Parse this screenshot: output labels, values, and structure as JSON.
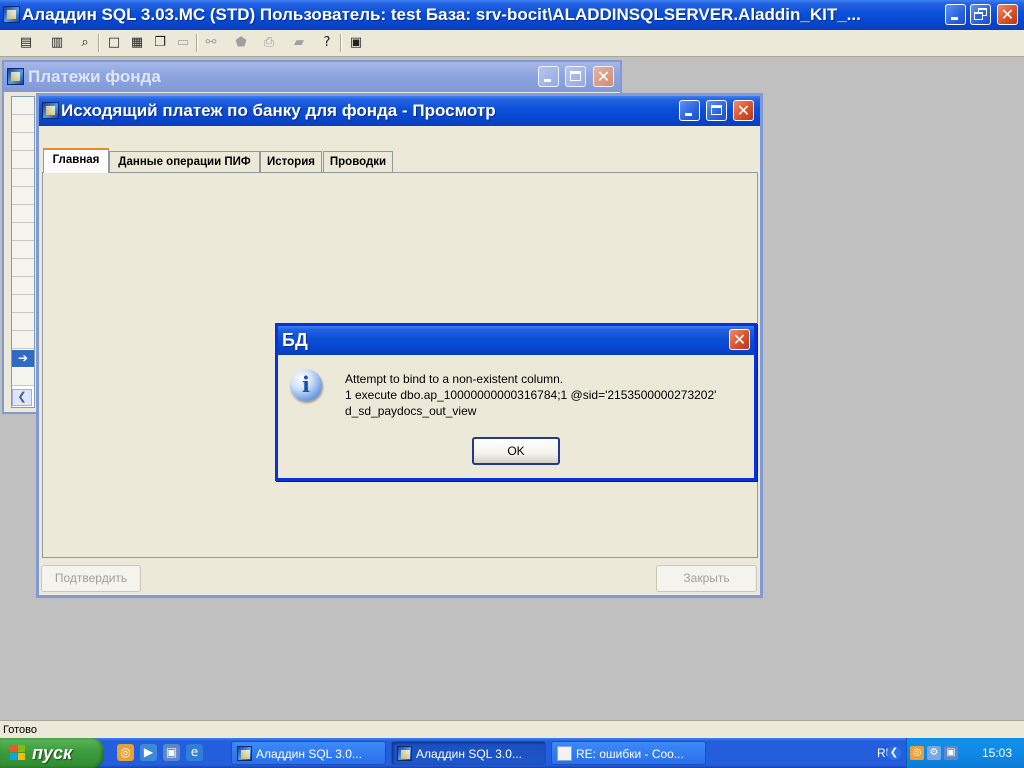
{
  "main_window": {
    "title": "Аладдин SQL 3.03.MC (STD)  Пользователь: test База: srv-bocit\\ALADDINSQLSERVER.Aladdin_KIT_..."
  },
  "toolbar": {
    "icons": [
      "document-list-icon",
      "cylinder-icon",
      "find-icon",
      "window-icon",
      "tile-icon",
      "cascade-icon",
      "window-disabled-icon",
      "binoculars-icon",
      "stamp-icon",
      "printer-icon",
      "filter-icon",
      "help-icon",
      "exit-icon"
    ]
  },
  "payments_window": {
    "title": "Платежи фонда"
  },
  "outgoing_window": {
    "title": "Исходящий платеж по банку для фонда - Просмотр",
    "tabs": [
      {
        "label": "Главная",
        "active": true
      },
      {
        "label": "Данные операции ПИФ",
        "active": false
      },
      {
        "label": "История",
        "active": false
      },
      {
        "label": "Проводки",
        "active": false
      }
    ],
    "confirm_label": "Подтвердить",
    "close_label": "Закрыть"
  },
  "message_box": {
    "title": "БД",
    "line1": "Attempt to bind to a non-existent column.",
    "line2": "1 execute dbo.ap_10000000000316784;1 @sid='2153500000273202'",
    "line3": "d_sd_paydocs_out_view",
    "ok_label": "OK"
  },
  "status_bar": {
    "text": "Готово"
  },
  "taskbar": {
    "start_label": "пуск",
    "tasks": [
      {
        "label": "Аладдин SQL 3.0...",
        "active": false
      },
      {
        "label": "Аладдин SQL 3.0...",
        "active": true
      },
      {
        "label": "RE: ошибки - Соо...",
        "active": false
      }
    ],
    "language": "RU",
    "clock": "15:03"
  },
  "colors": {
    "title_active": "#0a4fd8",
    "title_inactive": "#8fa6e0",
    "close_red": "#d9532a",
    "workspace": "#c0c0c0",
    "dialog_face": "#ece9d8"
  }
}
